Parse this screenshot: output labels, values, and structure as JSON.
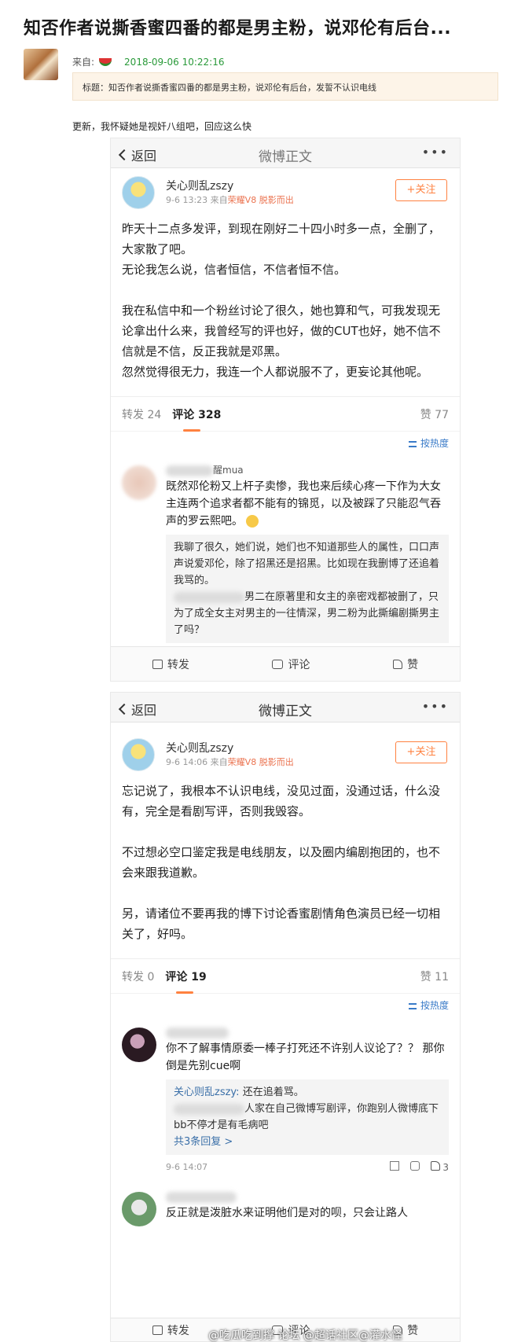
{
  "post": {
    "title": "知否作者说撕香蜜四番的都是男主粉，说邓伦有后台...",
    "from_label": "来自:",
    "date": "2018-09-06 10:22:16",
    "title_box": "标题：知否作者说撕香蜜四番的都是男主粉，说邓伦有后台，发誓不认识电线",
    "update": "更新，我怀疑她是视奸八组吧，回应这么快"
  },
  "shot1": {
    "nav": {
      "back": "返回",
      "title": "微博正文",
      "more": "•••"
    },
    "author": {
      "name": "关心则乱zszy",
      "time": "9-6 13:23",
      "from": "来自",
      "device": "荣耀V8 脱影而出",
      "follow": "+关注"
    },
    "paragraphs": [
      "昨天十二点多发评，到现在刚好二十四小时多一点，全删了，大家散了吧。",
      "无论我怎么说，信者恒信，不信者恒不信。",
      "我在私信中和一个粉丝讨论了很久，她也算和气，可我发现无论拿出什么来，我曾经写的评也好，做的CUT也好，她不信不信就是不信，反正我就是邓黑。",
      "忽然觉得很无力，我连一个人都说服不了，更妄论其他呢。"
    ],
    "stats": {
      "repost": "转发 24",
      "comment": "评论 328",
      "like": "赞 77"
    },
    "sort": "按热度",
    "comment": {
      "name_suffix": "醒mua",
      "text": "既然邓伦粉又上杆子卖惨，我也来后续心疼一下作为大女主连两个追求者都不能有的锦觅，以及被踩了只能忍气吞声的罗云熙吧。",
      "reply_line1": "我聊了很久，她们说，她们也不知道那些人的属性，口口声声说爱邓伦，除了招黑还是招黑。比如现在我删博了还追着我骂的。",
      "reply_line2": "男二在原著里和女主的亲密戏都被删了，只为了成全女主对男主的一往情深，男二粉为此撕编剧撕男主了吗？"
    },
    "actions": {
      "repost": "转发",
      "comment": "评论",
      "like": "赞"
    }
  },
  "shot2": {
    "nav": {
      "back": "返回",
      "title": "微博正文",
      "more": "•••"
    },
    "author": {
      "name": "关心则乱zszy",
      "time": "9-6 14:06",
      "from": "来自",
      "device": "荣耀V8 脱影而出",
      "follow": "+关注"
    },
    "paragraphs": [
      "忘记说了，我根本不认识电线，没见过面，没通过话，什么没有，完全是看剧写评，否则我毁容。",
      "不过想必空口鉴定我是电线朋友，以及圈内编剧抱团的，也不会来跟我道歉。",
      "另，请诸位不要再我的博下讨论香蜜剧情角色演员已经一切相关了，好吗。"
    ],
    "stats": {
      "repost": "转发 0",
      "comment": "评论 19",
      "like": "赞 11"
    },
    "sort": "按热度",
    "comment1": {
      "text": "你不了解事情原委一棒子打死还不许别人议论了？？ 那你倒是先别cue啊",
      "reply_name": "关心则乱zszy:",
      "reply_text": "还在追着骂。",
      "reply2_text": "人家在自己微博写剧评，你跑别人微博底下bb不停才是有毛病吧",
      "more_replies": "共3条回复 >",
      "time": "9-6 14:07",
      "like_count": "3"
    },
    "comment2": {
      "text": "反正就是泼脏水来证明他们是对的呗，只会让路人"
    },
    "actions": {
      "repost": "转发",
      "comment": "评论",
      "like": "赞"
    }
  },
  "watermark": "@吃瓜吃到撑 论坛 @超话社区@灌水怪"
}
